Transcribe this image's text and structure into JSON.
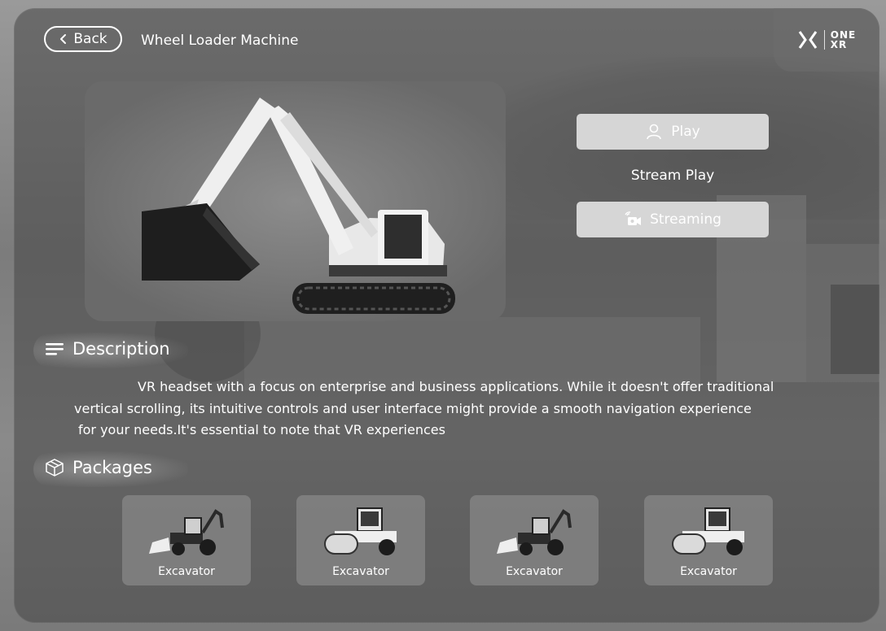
{
  "header": {
    "back_label": "Back",
    "title": "Wheel Loader Machine"
  },
  "logo": {
    "line1": "ONE",
    "line2": "XR"
  },
  "actions": {
    "play_label": "Play",
    "stream_play_label": "Stream Play",
    "streaming_label": "Streaming"
  },
  "description": {
    "heading": "Description",
    "line1": "VR headset with a focus on enterprise and business applications. While it doesn't offer traditional",
    "line2": "vertical scrolling, its intuitive controls and user interface might provide a smooth navigation experience",
    "line3": "for your needs.It's essential to note that VR experiences"
  },
  "packages": {
    "heading": "Packages",
    "items": [
      {
        "label": "Excavator",
        "icon": "backhoe-loader-icon"
      },
      {
        "label": "Excavator",
        "icon": "road-roller-icon"
      },
      {
        "label": "Excavator",
        "icon": "backhoe-loader-icon"
      },
      {
        "label": "Excavator",
        "icon": "road-roller-icon"
      }
    ]
  }
}
